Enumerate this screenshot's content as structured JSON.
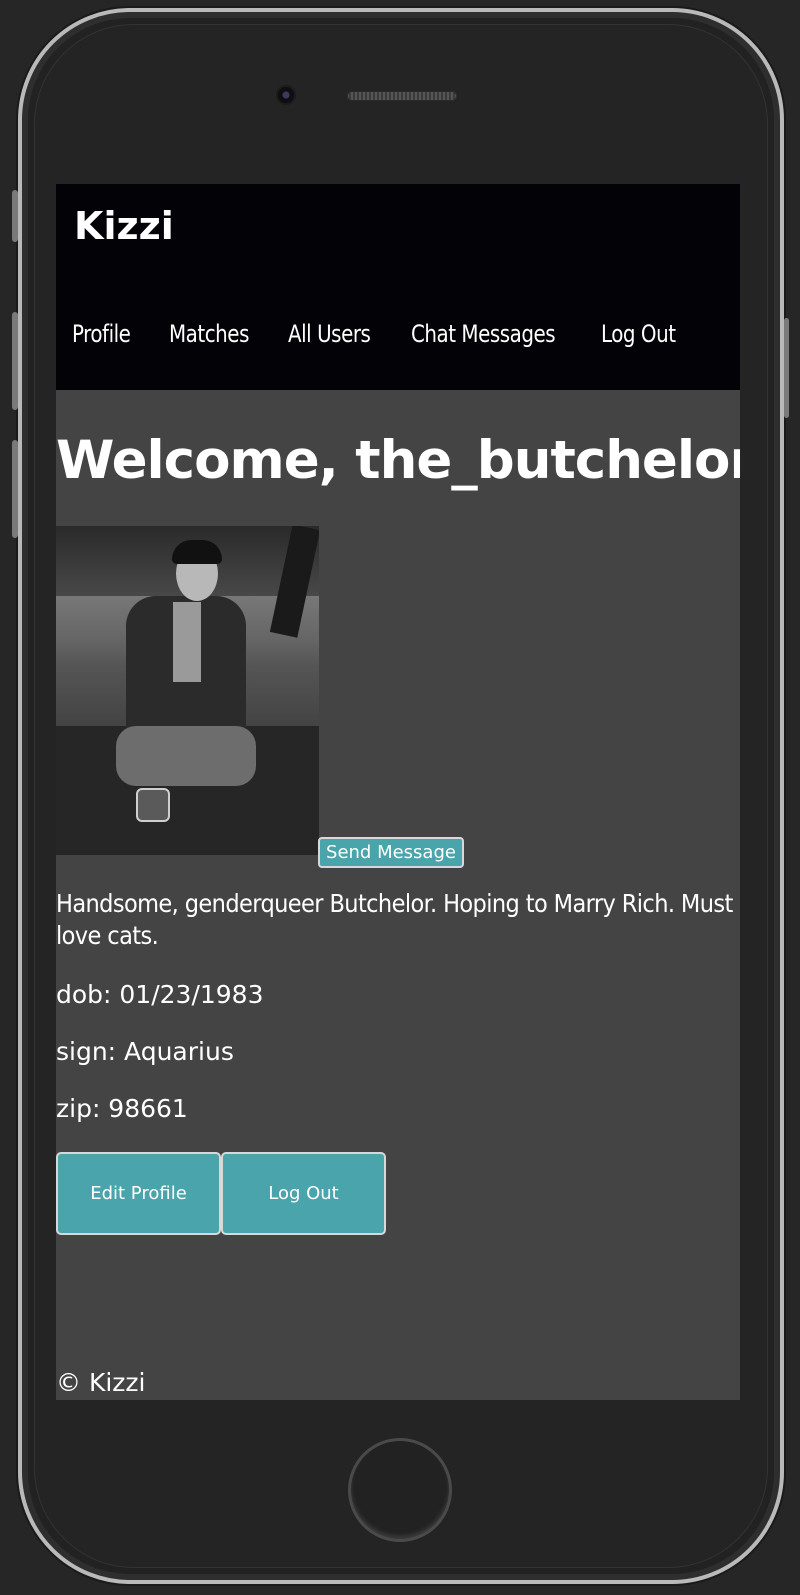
{
  "app": {
    "brand": "Kizzi"
  },
  "nav": {
    "items": [
      {
        "label": "Profile"
      },
      {
        "label": "Matches"
      },
      {
        "label": "All Users"
      },
      {
        "label": "Chat Messages"
      },
      {
        "label": "Log Out"
      }
    ]
  },
  "profile": {
    "welcome": "Welcome, the_butchelor!",
    "send_message_label": "Send Message",
    "bio": "Handsome, genderqueer Butchelor. Hoping to Marry Rich. Must love cats.",
    "dob": "dob: 01/23/1983",
    "sign": "sign: Aquarius",
    "zip": "zip: 98661"
  },
  "actions": {
    "edit_profile_label": "Edit Profile",
    "log_out_label": "Log Out"
  },
  "footer": {
    "text": "© Kizzi"
  },
  "colors": {
    "navbar_bg": "#030307",
    "page_bg": "#444444",
    "button_bg": "#4aa4ac",
    "text": "#ffffff"
  }
}
